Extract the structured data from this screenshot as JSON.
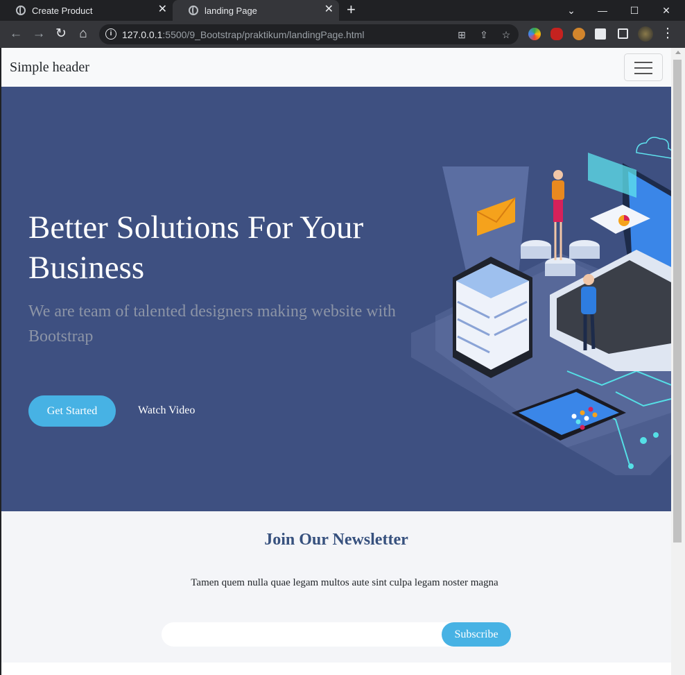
{
  "browser": {
    "tabs": [
      {
        "title": "Create Product",
        "active": false
      },
      {
        "title": "landing Page",
        "active": true
      }
    ],
    "new_tab": "+",
    "url_host": "127.0.0.1",
    "url_rest": ":5500/9_Bootstrap/praktikum/landingPage.html"
  },
  "header": {
    "brand": "Simple header"
  },
  "hero": {
    "title": "Better Solutions For Your Business",
    "subtitle": "We are team of talented designers making website with Bootstrap",
    "primary_button": "Get Started",
    "secondary_button": "Watch Video",
    "background_color": "#3e5081"
  },
  "newsletter": {
    "title": "Join Our Newsletter",
    "text": "Tamen quem nulla quae legam multos aute sint culpa legam noster magna",
    "email_value": "",
    "subscribe_label": "Subscribe",
    "accent_color": "#47b2e4"
  },
  "icons": {
    "back": "arrow-left-icon",
    "forward": "arrow-right-icon",
    "reload": "reload-icon",
    "home": "home-icon",
    "menu": "hamburger-icon"
  }
}
